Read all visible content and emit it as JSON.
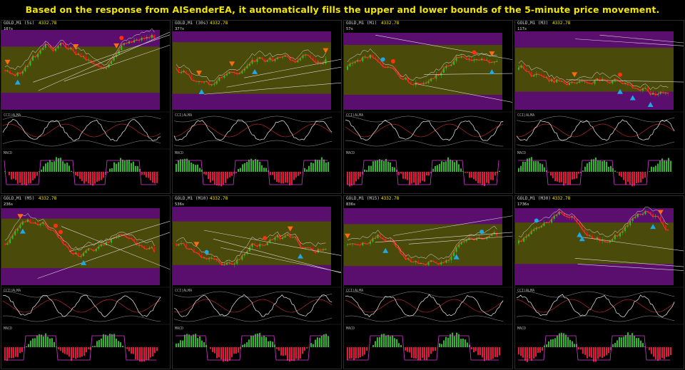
{
  "banner": {
    "text": "Based on the response from AISenderEA, it automatically fills the upper and lower bounds of the 5-minute price movement."
  },
  "colors": {
    "banner_text": "#f2e600",
    "band_purple": "#5a0f6e",
    "band_olive": "#4a4a0a",
    "bull_candle": "#22c322",
    "bear_candle": "#e01818",
    "signal_blue": "#1fa8e8",
    "signal_red": "#ff3010",
    "signal_orange": "#ff6a10",
    "macd_pos": "#2db82d",
    "macd_neg": "#e8163c",
    "macd_line": "#d23cd2"
  },
  "panels": [
    {
      "symbol": "GOLD,M1 (5s)",
      "price": "4332.78",
      "timer": "10?s",
      "cci_label": "CCI(ALMA",
      "macd_label": "MACD",
      "seed": 3
    },
    {
      "symbol": "GOLD,M1 (30s)",
      "price": "4332.78",
      "timer": "37?s",
      "cci_label": "CCI(ALMA",
      "macd_label": "MACD",
      "seed": 7
    },
    {
      "symbol": "GOLD,M1 (M1)",
      "price": "4332.78",
      "timer": "57s",
      "cci_label": "CCI(ALMA",
      "macd_label": "MACD",
      "seed": 11
    },
    {
      "symbol": "GOLD,M1 (M3)",
      "price": "4332.78",
      "timer": "117s",
      "cci_label": "CCI(ALMA",
      "macd_label": "MACD",
      "seed": 13
    },
    {
      "symbol": "GOLD,M1 (M5)",
      "price": "4332.78",
      "timer": "236s",
      "cci_label": "CCI(ALMA",
      "macd_label": "MACD",
      "seed": 17
    },
    {
      "symbol": "GOLD,M1 (M10)",
      "price": "4332.78",
      "timer": "536s",
      "cci_label": "CCI(ALMA",
      "macd_label": "MACD",
      "seed": 19
    },
    {
      "symbol": "GOLD,M1 (M15)",
      "price": "4332.78",
      "timer": "836s",
      "cci_label": "CCI(ALMA",
      "macd_label": "MACD",
      "seed": 23
    },
    {
      "symbol": "GOLD,M1 (M30)",
      "price": "4332.78",
      "timer": "1736s",
      "cci_label": "CCI(ALMA",
      "macd_label": "MACD",
      "seed": 29
    }
  ]
}
